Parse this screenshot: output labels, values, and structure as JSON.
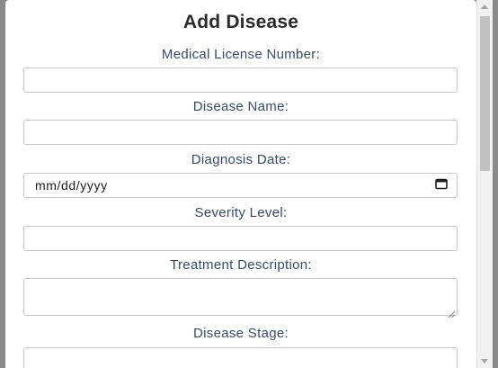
{
  "modal": {
    "title": "Add Disease",
    "fields": [
      {
        "label": "Medical License Number:",
        "value": ""
      },
      {
        "label": "Disease Name:",
        "value": ""
      },
      {
        "label": "Diagnosis Date:",
        "placeholder": "mm/dd/yyyy"
      },
      {
        "label": "Severity Level:",
        "value": ""
      },
      {
        "label": "Treatment Description:",
        "value": ""
      },
      {
        "label": "Disease Stage:",
        "value": ""
      }
    ]
  },
  "icons": {
    "date_picker": "calendar-icon",
    "resize": "resize-grip-icon",
    "scroll_up": "scroll-up-arrow-icon",
    "scroll_down": "scroll-down-arrow-icon"
  },
  "colors": {
    "label": "#3a4a66",
    "title": "#2b2b2b",
    "backdrop": "#8a8a8a"
  }
}
